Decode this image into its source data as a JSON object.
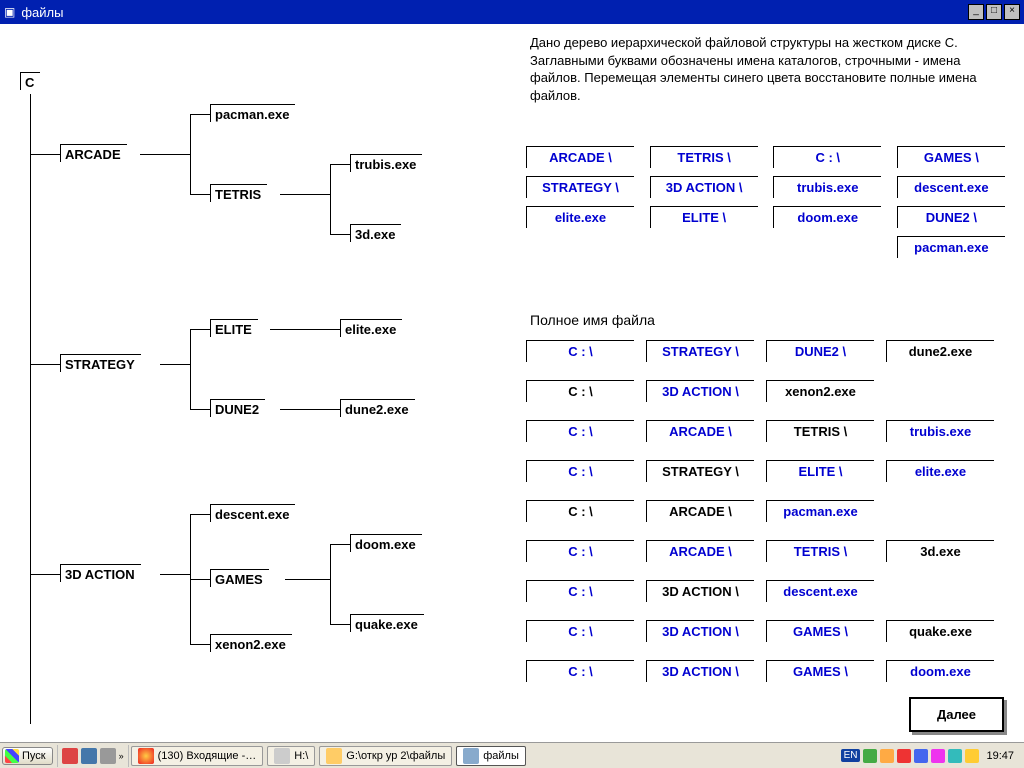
{
  "window_title": "файлы",
  "tree": {
    "root": "C",
    "arcade": "ARCADE",
    "pacman": "pacman.exe",
    "tetris": "TETRIS",
    "trubis": "trubis.exe",
    "d3": "3d.exe",
    "strategy": "STRATEGY",
    "elite": "ELITE",
    "elite_exe": "elite.exe",
    "dune2": "DUNE2",
    "dune2_exe": "dune2.exe",
    "action3d": "3D ACTION",
    "descent": "descent.exe",
    "games": "GAMES",
    "doom": "doom.exe",
    "quake": "quake.exe",
    "xenon2": "xenon2.exe"
  },
  "description": "Дано дерево иерархической файловой структуры на жестком диске С. Заглавными буквами обозначены имена каталогов, строчными - имена файлов. Перемещая элементы синего цвета восстановите полные имена файлов.",
  "chips": {
    "r1": [
      "ARCADE \\",
      "TETRIS \\",
      "C : \\",
      "GAMES \\"
    ],
    "r2": [
      "STRATEGY \\",
      "3D ACTION \\",
      "trubis.exe",
      "descent.exe"
    ],
    "r3": [
      "elite.exe",
      "ELITE \\",
      "doom.exe",
      "DUNE2 \\"
    ],
    "r4_last": "pacman.exe"
  },
  "subhead": "Полное имя файла",
  "paths": [
    [
      {
        "t": "C : \\",
        "c": "blue"
      },
      {
        "t": "STRATEGY \\",
        "c": "blue"
      },
      {
        "t": "DUNE2 \\",
        "c": "blue"
      },
      {
        "t": "dune2.exe",
        "c": "black"
      }
    ],
    [
      {
        "t": "C : \\",
        "c": "black"
      },
      {
        "t": "3D ACTION \\",
        "c": "blue"
      },
      {
        "t": "xenon2.exe",
        "c": "black"
      }
    ],
    [
      {
        "t": "C : \\",
        "c": "blue"
      },
      {
        "t": "ARCADE \\",
        "c": "blue"
      },
      {
        "t": "TETRIS \\",
        "c": "black"
      },
      {
        "t": "trubis.exe",
        "c": "blue"
      }
    ],
    [
      {
        "t": "C : \\",
        "c": "blue"
      },
      {
        "t": "STRATEGY \\",
        "c": "black"
      },
      {
        "t": "ELITE \\",
        "c": "blue"
      },
      {
        "t": "elite.exe",
        "c": "blue"
      }
    ],
    [
      {
        "t": "C : \\",
        "c": "black"
      },
      {
        "t": "ARCADE \\",
        "c": "black"
      },
      {
        "t": "pacman.exe",
        "c": "blue"
      }
    ],
    [
      {
        "t": "C : \\",
        "c": "blue"
      },
      {
        "t": "ARCADE \\",
        "c": "blue"
      },
      {
        "t": "TETRIS \\",
        "c": "blue"
      },
      {
        "t": "3d.exe",
        "c": "black"
      }
    ],
    [
      {
        "t": "C : \\",
        "c": "blue"
      },
      {
        "t": "3D ACTION \\",
        "c": "black"
      },
      {
        "t": "descent.exe",
        "c": "blue"
      }
    ],
    [
      {
        "t": "C : \\",
        "c": "blue"
      },
      {
        "t": "3D ACTION \\",
        "c": "blue"
      },
      {
        "t": "GAMES \\",
        "c": "blue"
      },
      {
        "t": "quake.exe",
        "c": "black"
      }
    ],
    [
      {
        "t": "C : \\",
        "c": "blue"
      },
      {
        "t": "3D ACTION \\",
        "c": "blue"
      },
      {
        "t": "GAMES \\",
        "c": "blue"
      },
      {
        "t": "doom.exe",
        "c": "blue"
      }
    ]
  ],
  "next_button": "Далее",
  "taskbar": {
    "start": "Пуск",
    "task1": "(130) Входящие -…",
    "task2": "H:\\",
    "task3": "G:\\откр ур 2\\файлы",
    "task4": "файлы",
    "lang": "EN",
    "clock": "19:47"
  }
}
